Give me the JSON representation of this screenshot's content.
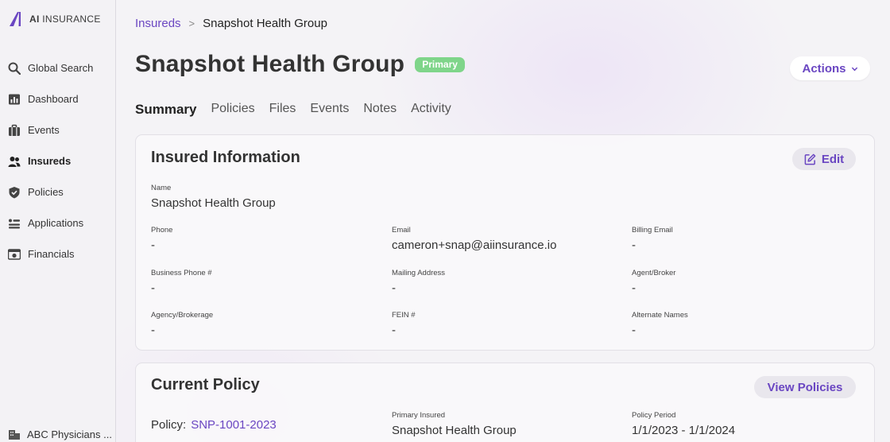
{
  "brand": {
    "bold": "AI",
    "rest": " INSURANCE",
    "accent": "#6a46c2"
  },
  "sidebar": {
    "items": [
      {
        "label": "Global Search",
        "icon": "search-icon"
      },
      {
        "label": "Dashboard",
        "icon": "chart-icon"
      },
      {
        "label": "Events",
        "icon": "briefcase-icon"
      },
      {
        "label": "Insureds",
        "icon": "users-icon",
        "active": true
      },
      {
        "label": "Policies",
        "icon": "shield-icon"
      },
      {
        "label": "Applications",
        "icon": "list-icon"
      },
      {
        "label": "Financials",
        "icon": "money-icon"
      }
    ],
    "org": "ABC Physicians ..."
  },
  "breadcrumb": {
    "parent": "Insureds",
    "separator": ">",
    "current": "Snapshot Health Group"
  },
  "header": {
    "title": "Snapshot Health Group",
    "badge": "Primary",
    "badge_color": "#7fd58a",
    "actions_label": "Actions"
  },
  "tabs": [
    "Summary",
    "Policies",
    "Files",
    "Events",
    "Notes",
    "Activity"
  ],
  "insured_info": {
    "title": "Insured Information",
    "edit_label": "Edit",
    "name_label": "Name",
    "name_value": "Snapshot Health Group",
    "fields": [
      {
        "label": "Phone",
        "value": "-"
      },
      {
        "label": "Email",
        "value": "cameron+snap@aiinsurance.io"
      },
      {
        "label": "Billing Email",
        "value": "-"
      },
      {
        "label": "Business Phone #",
        "value": "-"
      },
      {
        "label": "Mailing Address",
        "value": "-"
      },
      {
        "label": "Agent/Broker",
        "value": "-"
      },
      {
        "label": "Agency/Brokerage",
        "value": "-"
      },
      {
        "label": "FEIN #",
        "value": "-"
      },
      {
        "label": "Alternate Names",
        "value": "-"
      }
    ]
  },
  "current_policy": {
    "title": "Current Policy",
    "view_label": "View Policies",
    "policy_label": "Policy:",
    "policy_number": "SNP-1001-2023",
    "primary_insured_label": "Primary Insured",
    "primary_insured_value": "Snapshot Health Group",
    "period_label": "Policy Period",
    "period_value": "1/1/2023 - 1/1/2024"
  }
}
